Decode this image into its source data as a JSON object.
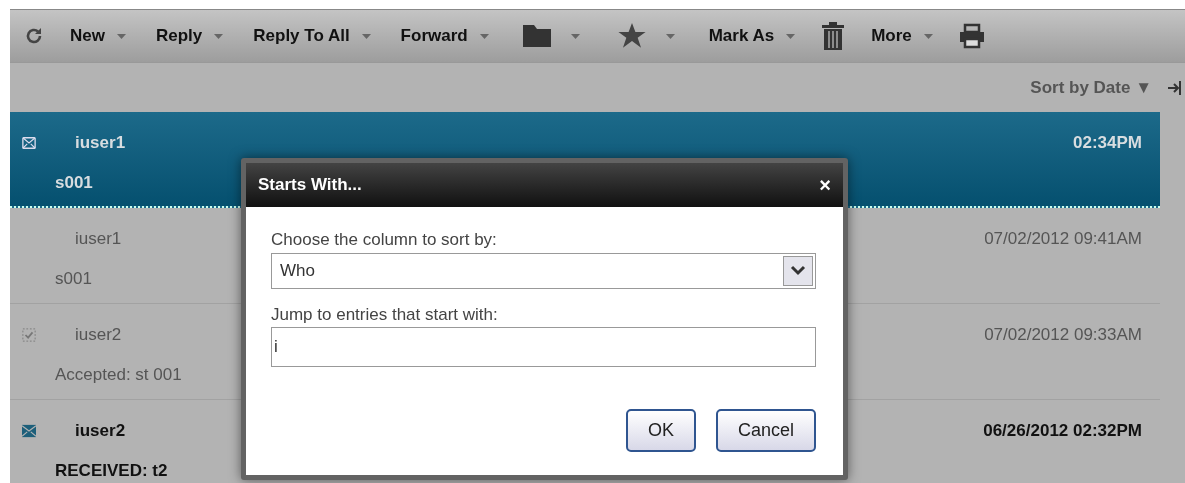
{
  "toolbar": [
    {
      "kind": "refresh"
    },
    {
      "kind": "menu",
      "label": "New"
    },
    {
      "kind": "menu",
      "label": "Reply"
    },
    {
      "kind": "menu",
      "label": "Reply To All"
    },
    {
      "kind": "menu",
      "label": "Forward"
    },
    {
      "kind": "folder-menu"
    },
    {
      "kind": "star-menu"
    },
    {
      "kind": "menu",
      "label": "Mark As"
    },
    {
      "kind": "trash"
    },
    {
      "kind": "menu",
      "label": "More"
    },
    {
      "kind": "print"
    }
  ],
  "sort": {
    "label": "Sort by Date ▼"
  },
  "messages": [
    {
      "kind": "read",
      "who": "iuser1",
      "subject": "s001",
      "date": "02:34PM",
      "selected": true,
      "unread": false
    },
    {
      "kind": "plain",
      "who": "iuser1",
      "subject": "s001",
      "date": "07/02/2012 09:41AM",
      "selected": false,
      "unread": false
    },
    {
      "kind": "accepted",
      "who": "iuser2",
      "subject": "Accepted: st 001",
      "date": "07/02/2012 09:33AM",
      "selected": false,
      "unread": false
    },
    {
      "kind": "unread",
      "who": "iuser2",
      "subject": "RECEIVED: t2",
      "date": "06/26/2012 02:32PM",
      "selected": false,
      "unread": true
    }
  ],
  "dialog": {
    "title": "Starts With...",
    "close": "×",
    "column_label": "Choose the column to sort by:",
    "column_value": "Who",
    "jump_label": "Jump to entries that start with:",
    "jump_value": "i",
    "buttons": [
      "OK",
      "Cancel"
    ]
  }
}
